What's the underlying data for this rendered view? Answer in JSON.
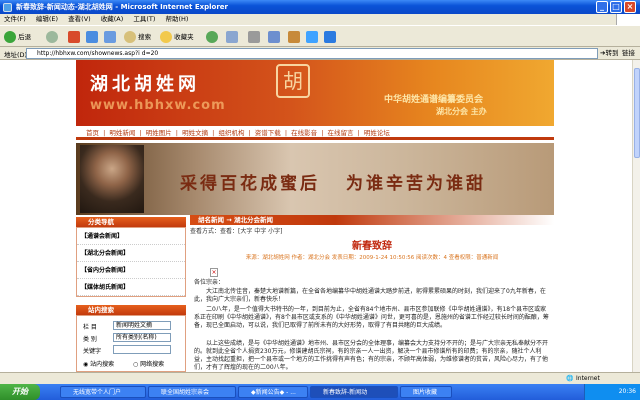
{
  "window": {
    "title": "新春致辞-新闻动态-湖北胡姓网 - Microsoft Internet Explorer",
    "controls": {
      "minimize": "_",
      "maximize": "□",
      "close": "×"
    }
  },
  "menubar": [
    "文件(F)",
    "编辑(E)",
    "查看(V)",
    "收藏(A)",
    "工具(T)",
    "帮助(H)"
  ],
  "toolbar": {
    "back": "后退",
    "search": "搜索",
    "favorites": "收藏夹"
  },
  "address": {
    "label": "地址(D)",
    "url": "http://hbhxw.com/shownews.asp?i d=20",
    "go": "转到",
    "links": "链接"
  },
  "site": {
    "logo": "湖北胡姓网",
    "url_text": "www.hbhxw.com",
    "seal": "胡",
    "assoc_line1": "中华胡姓通谱编纂委员会",
    "assoc_line2": "湖北分会 主办",
    "nav": [
      "首页",
      "|",
      "明姓新闻",
      "|",
      "明姓图片",
      "|",
      "明姓文摘",
      "|",
      "组织机构",
      "|",
      "资谱下载",
      "|",
      "在线影音",
      "|",
      "在线留言",
      "|",
      "明姓论坛"
    ],
    "slogan1": "采得百花成蜜后",
    "slogan2": "为谁辛苦为谁甜"
  },
  "sidebar": {
    "category_title": "分类导航",
    "categories": [
      "【通谱会新闻】",
      "【湖北分会新闻】",
      "【省内分会新闻】",
      "【媒体胡氏新闻】"
    ],
    "search_title": "站内搜索",
    "search_rows": [
      {
        "label": "栏 目",
        "value": "新闻明姓文摘"
      },
      {
        "label": "类 别",
        "value": "所有类别(名称)"
      },
      {
        "label": "关键字",
        "value": ""
      }
    ],
    "radio1": "站内搜索",
    "radio2": "网络搜索"
  },
  "content": {
    "breadcrumb": "胡名新闻 → 湖北分会新闻",
    "view_mode": "查看方式：查看：[大字 中字 小字]",
    "title": "新春致辞",
    "meta": "来源：湖北胡姓网 作者：湖北分会 发表日期：2009-1-24 10:50:56 阅读次数：4 查看权限：普通新闻",
    "img_placeholder": "×",
    "paragraphs": [
      "各位宗亲：",
      "大江南北传佳音，秦楚大地谱新篇，在全省各地编纂华中胡姓通谱大踏步前进，躬得累累硕果的时刻，我们迎来了0九年新春，在此，我向广大宗亲们，新春快乐！",
      "二0八年，是一个值得大书特书的一年，到目前为止，全省有84个地市州、县市区参加联修《中华胡姓通谱》，有18个县市区或家系正在印刷《中华胡姓通谱》，有8个县市区或支系的《中华胡姓通谱》问世，更可喜的是，恩施州的省谱工作经过较长时间的酝酿，筹备，现已全面启动，可以说，我们已取得了前所未有的大好形势，取得了有目共睹的巨大成绩。",
      "以上这些成绩，是与《中华胡姓通谱》地市州、县市区分会的全体理事，编纂会大力支持分不开的；是与广大宗亲无私奉献分不开的。就到此全省个人捐资230万元，修谱建胡氏宗祠，有的宗亲一人一出资，解决一个县市修谱所有的印费；有的宗亲，随社个人利益，主动找起重担，把一个县市或一个地方的工作挑得有声有色；有的宗亲，不顾年高体弱，为维修谱者的贫苦，风险心尽力，有了他们，才有了辉煌的现在的二00八年。"
    ]
  },
  "statusbar": {
    "zone": "Internet"
  },
  "taskbar": {
    "start": "开始",
    "tasks": [
      "无线宽带个人门户",
      "联全国胡姓宗亲会",
      "◆新闻公告◆ - ...",
      "新春致辞-新闻动",
      "图片收藏"
    ],
    "clock": "20:36"
  }
}
